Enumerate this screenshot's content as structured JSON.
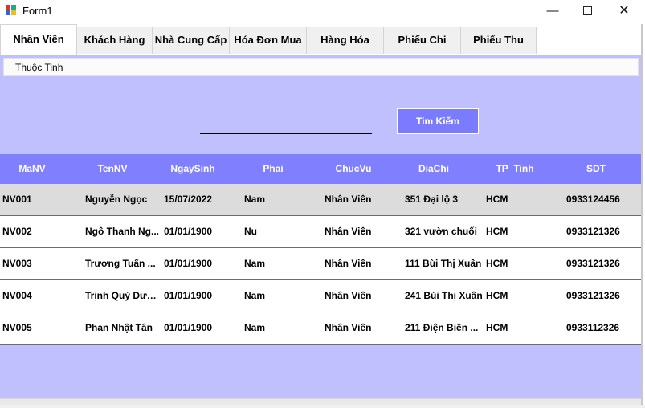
{
  "window": {
    "title": "Form1",
    "minimize_glyph": "—",
    "close_glyph": "✕"
  },
  "tabs": [
    {
      "label": "Nhân Viên",
      "active": true
    },
    {
      "label": "Khách Hàng"
    },
    {
      "label": "Nhà Cung Cấp"
    },
    {
      "label": "Hóa Đơn Mua"
    },
    {
      "label": "Hàng Hóa"
    },
    {
      "label": "Phiếu Chi"
    },
    {
      "label": "Phiếu Thu"
    }
  ],
  "property_bar": {
    "label": "Thuộc Tinh"
  },
  "search": {
    "value": "",
    "button_label": "Tim Kiếm"
  },
  "grid": {
    "columns": [
      "MaNV",
      "TenNV",
      "NgaySinh",
      "Phai",
      "ChucVu",
      "DiaChi",
      "TP_Tinh",
      "SDT"
    ],
    "rows": [
      [
        "NV001",
        "Nguyễn Ngọc",
        "15/07/2022",
        "Nam",
        "Nhân Viên",
        "351 Đại lộ 3",
        "HCM",
        "0933124456"
      ],
      [
        "NV002",
        "Ngô Thanh Ng...",
        "01/01/1900",
        "Nu",
        "Nhân Viên",
        "321 vườn chuối",
        "HCM",
        "0933121326"
      ],
      [
        "NV003",
        "Trương Tuấn ...",
        "01/01/1900",
        "Nam",
        "Nhân Viên",
        "111 Bùi Thị Xuân",
        "HCM",
        "0933121326"
      ],
      [
        "NV004",
        "Trịnh Quý Dươ...",
        "01/01/1900",
        "Nam",
        "Nhân Viên",
        "241 Bùi Thị Xuân",
        "HCM",
        "0933121326"
      ],
      [
        "NV005",
        "Phan Nhật Tân",
        "01/01/1900",
        "Nam",
        "Nhân Viên",
        "211 Điện Biên ...",
        "HCM",
        "0933112326"
      ]
    ],
    "selected_row": 0
  },
  "colors": {
    "panel_background": "#c0c0ff",
    "header_background": "#8080ff",
    "button_background": "#7b7bff",
    "selected_row": "#dcdcdc"
  }
}
